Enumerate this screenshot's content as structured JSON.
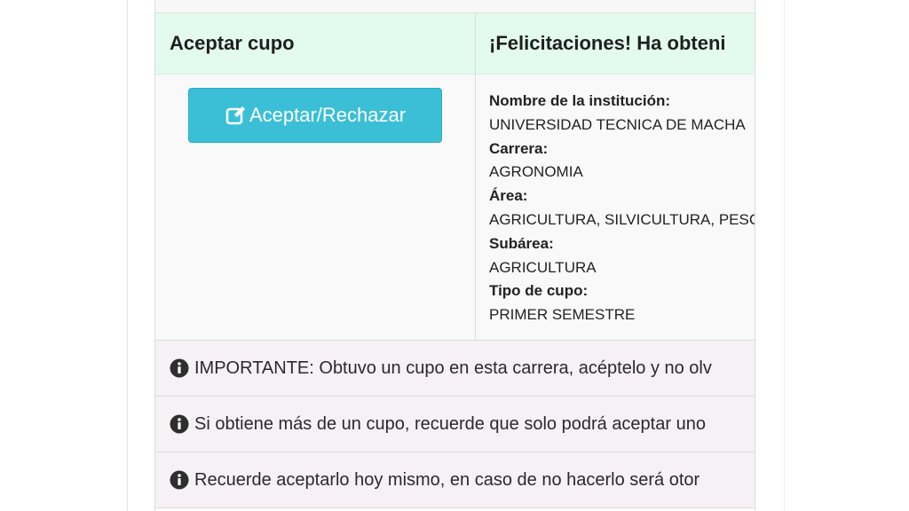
{
  "header": {
    "left_title": "Aceptar cupo",
    "right_title": "¡Felicitaciones! Ha obteni"
  },
  "action": {
    "accept_label": "Aceptar/Rechazar",
    "icon": "edit-icon",
    "color": "#3bbfd6"
  },
  "details": {
    "institucion_label": "Nombre de la institución:",
    "institucion_value": "UNIVERSIDAD TECNICA DE MACHA",
    "carrera_label": "Carrera:",
    "carrera_value": "AGRONOMIA",
    "area_label": "Área:",
    "area_value": "AGRICULTURA, SILVICULTURA, PESC",
    "subarea_label": "Subárea:",
    "subarea_value": "AGRICULTURA",
    "tipo_label": "Tipo de cupo:",
    "tipo_value": "PRIMER SEMESTRE"
  },
  "notices": [
    {
      "icon": "info-icon",
      "text": "IMPORTANTE: Obtuvo un cupo en esta carrera, acéptelo y no olv"
    },
    {
      "icon": "info-icon",
      "text": "Si obtiene más de un cupo, recuerde que solo podrá aceptar uno"
    },
    {
      "icon": "info-icon",
      "text": "Recuerde aceptarlo hoy mismo, en caso de no hacerlo será otor"
    }
  ],
  "colors": {
    "header_bg": "#e3fbee",
    "notice_bg": "#f6f1f5",
    "button": "#3bbfd6"
  }
}
